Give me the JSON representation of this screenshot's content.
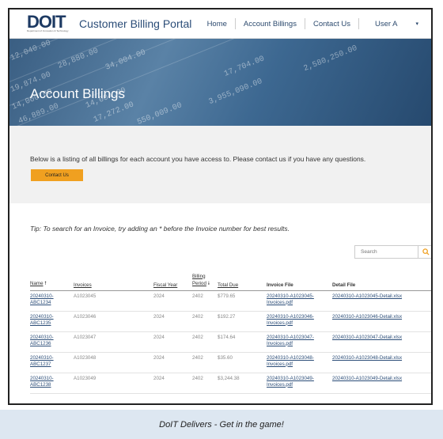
{
  "header": {
    "logo_text": "DOIT",
    "logo_sub": "Department of Innovation & Technology",
    "portal_title": "Customer Billing Portal",
    "nav": [
      "Home",
      "Account Billings",
      "Contact Us"
    ],
    "user_label": "User A"
  },
  "banner": {
    "title": "Account Billings",
    "numbers": [
      "12,040.00",
      "28,880.00",
      "34,004.00",
      "19,874.00",
      "14,000.00",
      "46,889.00",
      "14,004.00",
      "17,272.00",
      "550,009.00",
      "3,955,090.00",
      "2,580,250.00",
      "17,704.00"
    ]
  },
  "intro": {
    "text": "Below is a listing of all billings for each account you have access to. Please contact us if you have any questions.",
    "contact_button": "Contact Us"
  },
  "tip": "Tip: To search for an Invoice, try adding an * before the Invoice number for best results.",
  "search": {
    "placeholder": "Search"
  },
  "table": {
    "headers": {
      "name": "Name",
      "invoices": "Invoices",
      "fiscal_year": "Fiscal Year",
      "billing_period": "Billing Period",
      "total_due": "Total Due",
      "invoice_file": "Invoice File",
      "detail_file": "Detail File"
    },
    "rows": [
      {
        "name": "20240310-ABC1234",
        "invoice": "A1023045",
        "fy": "2024",
        "period": "2402",
        "total": "$779.65",
        "invoice_file": "20240310-A1023045-Invoices.pdf",
        "detail_file": "20240310-A1023045-Detail.xlsx"
      },
      {
        "name": "20240310-ABC1235",
        "invoice": "A1023046",
        "fy": "2024",
        "period": "2402",
        "total": "$192.27",
        "invoice_file": "20240310-A1023046-Invoices.pdf",
        "detail_file": "20240310-A1023046-Detail.xlsx"
      },
      {
        "name": "20240310-ABC1236",
        "invoice": "A1023047",
        "fy": "2024",
        "period": "2402",
        "total": "$174.64",
        "invoice_file": "20240310-A1023047-Invoices.pdf",
        "detail_file": "20240310-A1023047-Detail.xlsx"
      },
      {
        "name": "20240310-ABC1237",
        "invoice": "A1023048",
        "fy": "2024",
        "period": "2402",
        "total": "$35.60",
        "invoice_file": "20240310-A1023048-Invoices.pdf",
        "detail_file": "20240310-A1023048-Detail.xlsx"
      },
      {
        "name": "20240310-ABC1238",
        "invoice": "A1023049",
        "fy": "2024",
        "period": "2402",
        "total": "$3,244.38",
        "invoice_file": "20240310-A1023049-Invoices.pdf",
        "detail_file": "20240310-A1023049-Detail.xlsx"
      }
    ]
  },
  "caption": "DoIT Delivers - Get in the game!",
  "colors": {
    "accent": "#f0a020",
    "brand": "#1d3a63",
    "caption_bg": "#dde7f1"
  }
}
